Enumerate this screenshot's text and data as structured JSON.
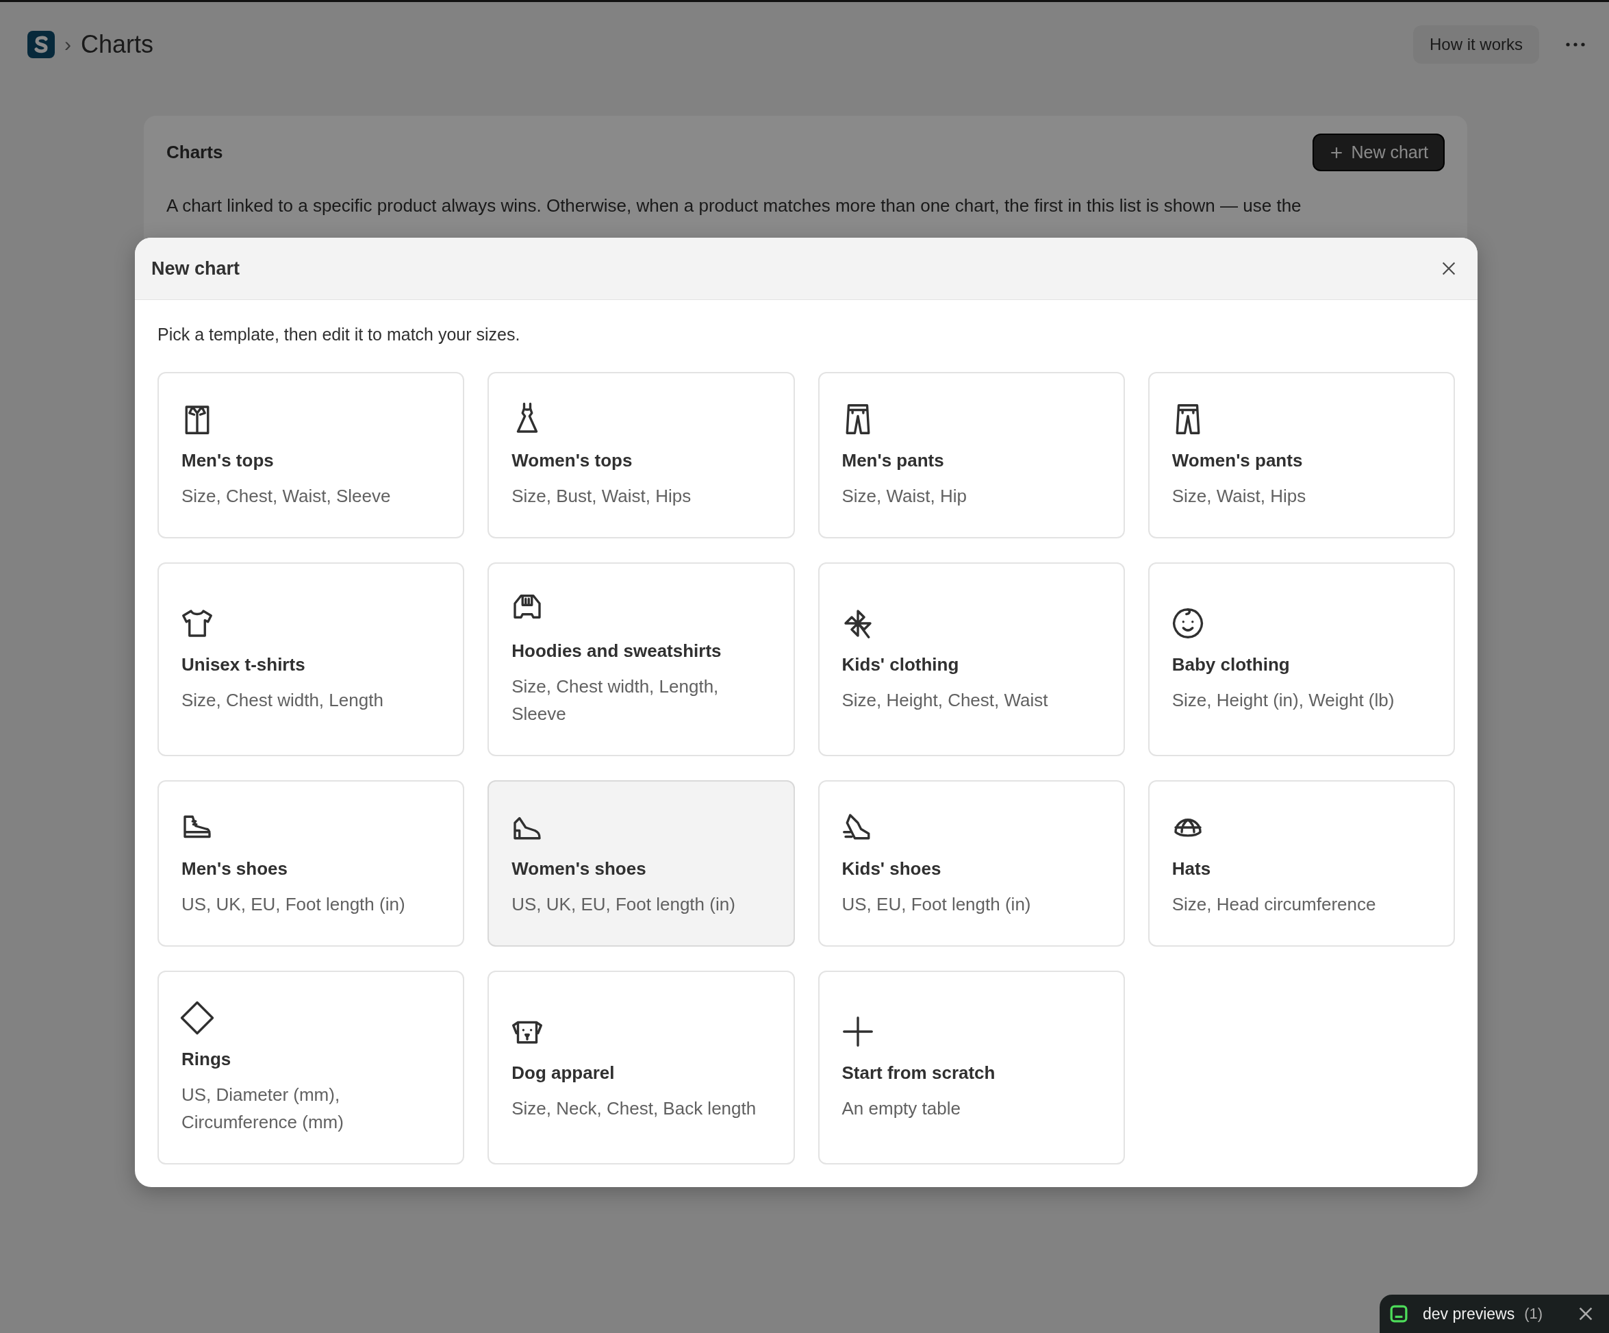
{
  "header": {
    "separator": "›",
    "title": "Charts",
    "help_button": "How it works"
  },
  "charts_card": {
    "title": "Charts",
    "new_button": "New chart",
    "description": "A chart linked to a specific product always wins. Otherwise, when a product matches more than one chart, the first in this list is shown — use the"
  },
  "modal": {
    "title": "New chart",
    "intro": "Pick a template, then edit it to match your sizes.",
    "templates": [
      {
        "title": "Men's tops",
        "fields": "Size, Chest, Waist, Sleeve",
        "hovered": false
      },
      {
        "title": "Women's tops",
        "fields": "Size, Bust, Waist, Hips",
        "hovered": false
      },
      {
        "title": "Men's pants",
        "fields": "Size, Waist, Hip",
        "hovered": false
      },
      {
        "title": "Women's pants",
        "fields": "Size, Waist, Hips",
        "hovered": false
      },
      {
        "title": "Unisex t-shirts",
        "fields": "Size, Chest width, Length",
        "hovered": false
      },
      {
        "title": "Hoodies and sweatshirts",
        "fields": "Size, Chest width, Length, Sleeve",
        "hovered": false
      },
      {
        "title": "Kids' clothing",
        "fields": "Size, Height, Chest, Waist",
        "hovered": false
      },
      {
        "title": "Baby clothing",
        "fields": "Size, Height (in), Weight (lb)",
        "hovered": false
      },
      {
        "title": "Men's shoes",
        "fields": "US, UK, EU, Foot length (in)",
        "hovered": false
      },
      {
        "title": "Women's shoes",
        "fields": "US, UK, EU, Foot length (in)",
        "hovered": true
      },
      {
        "title": "Kids' shoes",
        "fields": "US, EU, Foot length (in)",
        "hovered": false
      },
      {
        "title": "Hats",
        "fields": "Size, Head circumference",
        "hovered": false
      },
      {
        "title": "Rings",
        "fields": "US, Diameter (mm), Circumference (mm)",
        "hovered": false
      },
      {
        "title": "Dog apparel",
        "fields": "Size, Neck, Chest, Back length",
        "hovered": false
      },
      {
        "title": "Start from scratch",
        "fields": "An empty table",
        "hovered": false
      }
    ]
  },
  "dev_bar": {
    "label": "dev previews",
    "count": "(1)"
  }
}
